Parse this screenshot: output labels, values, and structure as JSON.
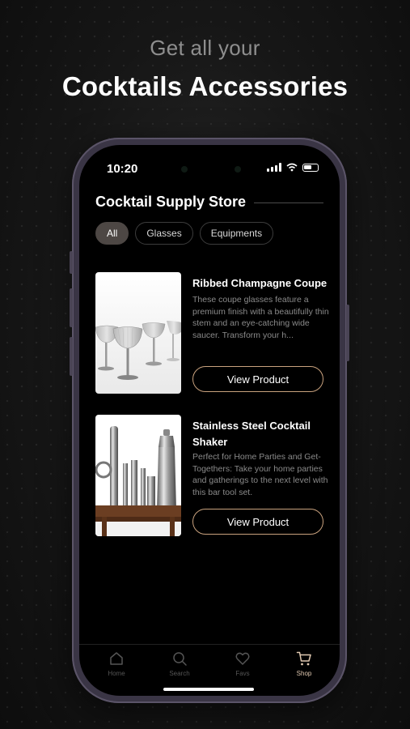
{
  "promo": {
    "subtitle": "Get all your",
    "title": "Cocktails Accessories"
  },
  "status_bar": {
    "time": "10:20"
  },
  "store": {
    "title": "Cocktail Supply Store"
  },
  "filters": [
    {
      "label": "All",
      "active": true
    },
    {
      "label": "Glasses",
      "active": false
    },
    {
      "label": "Equipments",
      "active": false
    }
  ],
  "products": [
    {
      "title": "Ribbed Champagne Coupe",
      "description": "These coupe glasses feature a premium finish with a beautifully thin stem and an eye-catching wide saucer. Transform your h...",
      "button_label": "View Product"
    },
    {
      "title": "Stainless Steel Cocktail Shaker",
      "description": "Perfect for Home Parties and Get-Togethers: Take your home parties and gatherings to the next level with this bar tool set.",
      "button_label": "View Product"
    }
  ],
  "tabs": [
    {
      "label": "Home",
      "icon": "home-icon",
      "active": false
    },
    {
      "label": "Search",
      "icon": "search-icon",
      "active": false
    },
    {
      "label": "Favs",
      "icon": "heart-icon",
      "active": false
    },
    {
      "label": "Shop",
      "icon": "cart-icon",
      "active": true
    }
  ],
  "colors": {
    "accent": "#c9a27e",
    "chip_active": "#4d4744",
    "background": "#000000"
  }
}
